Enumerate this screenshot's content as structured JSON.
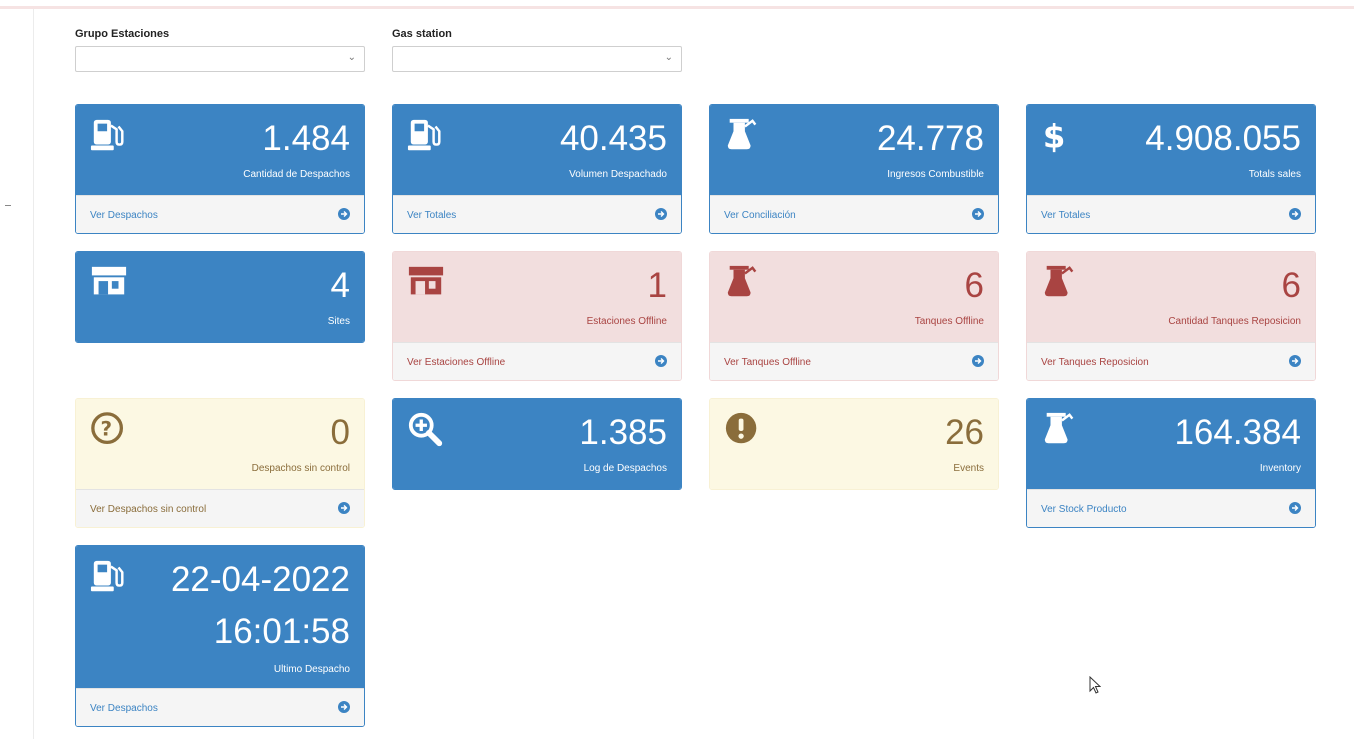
{
  "filters": {
    "group_label": "Grupo Estaciones",
    "group_value": "",
    "station_label": "Gas station",
    "station_value": ""
  },
  "cards": {
    "despachos": {
      "value": "1.484",
      "label": "Cantidad de Despachos",
      "link": "Ver Despachos",
      "icon": "gas-pump-icon",
      "color": "#3c84c3"
    },
    "volumen": {
      "value": "40.435",
      "label": "Volumen Despachado",
      "link": "Ver Totales",
      "icon": "gas-pump-icon",
      "color": "#3c84c3"
    },
    "ingresos": {
      "value": "24.778",
      "label": "Ingresos Combustible",
      "link": "Ver Conciliación",
      "icon": "flask-icon",
      "color": "#3c84c3"
    },
    "sales": {
      "value": "4.908.055",
      "label": "Totals sales",
      "link": "Ver Totales",
      "icon": "dollar-icon",
      "color": "#3c84c3"
    },
    "sites": {
      "value": "4",
      "label": "Sites",
      "icon": "store-icon",
      "color": "#3c84c3"
    },
    "estaciones_offline": {
      "value": "1",
      "label": "Estaciones Offline",
      "link": "Ver Estaciones Offline",
      "icon": "store-icon",
      "color": "#a94442"
    },
    "tanques_offline": {
      "value": "6",
      "label": "Tanques Offline",
      "link": "Ver Tanques Offline",
      "icon": "flask-icon",
      "color": "#a94442"
    },
    "tanques_reposicion": {
      "value": "6",
      "label": "Cantidad Tanques Reposicion",
      "link": "Ver Tanques Reposicion",
      "icon": "flask-icon",
      "color": "#a94442"
    },
    "sin_control": {
      "value": "0",
      "label": "Despachos sin control",
      "link": "Ver Despachos sin control",
      "icon": "question-circle-icon",
      "color": "#8a6d3b"
    },
    "log": {
      "value": "1.385",
      "label": "Log de Despachos",
      "icon": "zoom-in-icon",
      "color": "#3c84c3"
    },
    "events": {
      "value": "26",
      "label": "Events",
      "icon": "exclamation-circle-icon",
      "color": "#8a6d3b"
    },
    "inventory": {
      "value": "164.384",
      "label": "Inventory",
      "link": "Ver Stock Producto",
      "icon": "flask-icon",
      "color": "#3c84c3"
    },
    "ultimo": {
      "date": "22-04-2022",
      "time": "16:01:58",
      "label": "Ultimo Despacho",
      "link": "Ver Despachos",
      "icon": "gas-pump-icon",
      "color": "#3c84c3"
    }
  }
}
